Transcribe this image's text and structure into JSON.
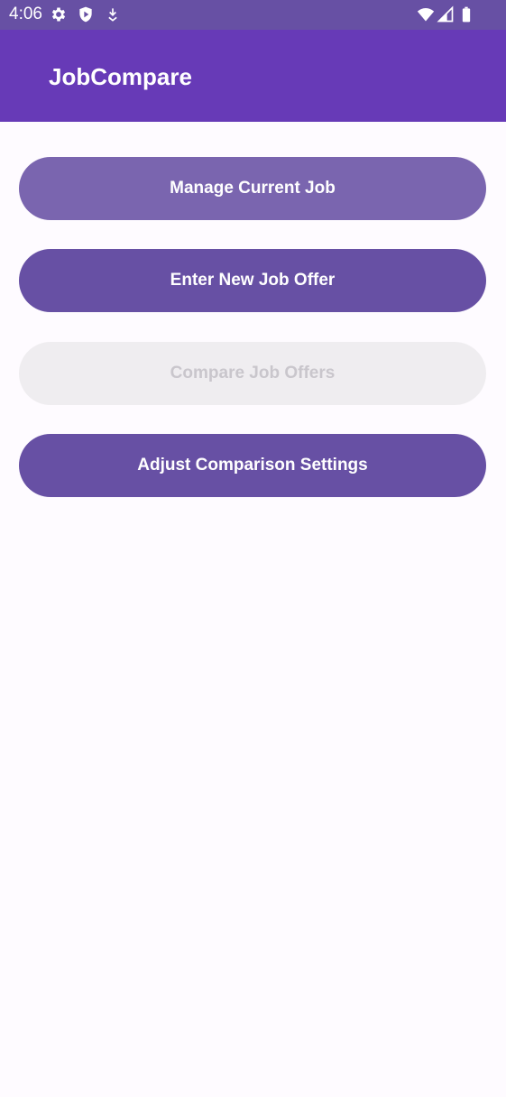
{
  "status_bar": {
    "time": "4:06",
    "icons": [
      "gear-icon",
      "shield-icon",
      "download-icon",
      "wifi-icon",
      "signal-icon",
      "battery-icon"
    ]
  },
  "app_bar": {
    "title": "JobCompare"
  },
  "colors": {
    "status_bar": "#6750a4",
    "app_bar": "#673ab7",
    "button_primary": "#6750a4",
    "button_pressed": "#7a65af",
    "button_disabled": "#efedf0",
    "button_disabled_text": "#c9c6cc",
    "background": "#fefbff"
  },
  "main": {
    "buttons": [
      {
        "label": "Manage Current Job",
        "state": "pressed"
      },
      {
        "label": "Enter New Job Offer",
        "state": "enabled"
      },
      {
        "label": "Compare Job Offers",
        "state": "disabled"
      },
      {
        "label": "Adjust Comparison Settings",
        "state": "enabled"
      }
    ]
  }
}
